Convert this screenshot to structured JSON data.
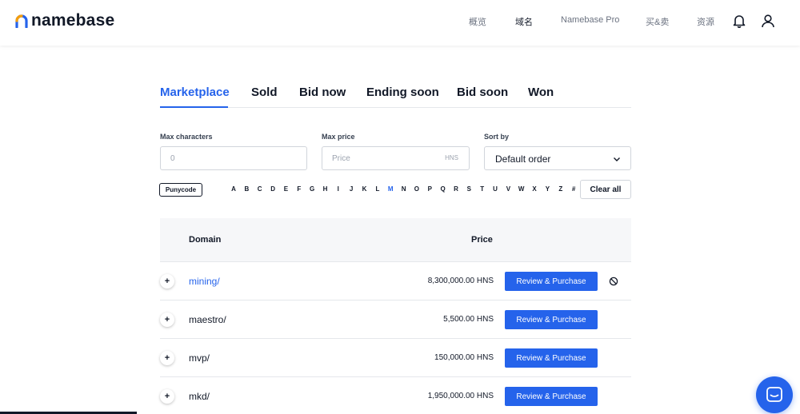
{
  "header": {
    "logo": "namebase",
    "nav": [
      "概览",
      "域名",
      "Namebase Pro",
      "买&卖",
      "资源"
    ],
    "active_nav": "域名",
    "icons": [
      "bell-icon",
      "user-icon"
    ]
  },
  "tabs": [
    "Marketplace",
    "Sold",
    "Bid now",
    "Ending soon",
    "Bid soon",
    "Won"
  ],
  "active_tab": "Marketplace",
  "filters": {
    "max_characters": {
      "label": "Max characters",
      "placeholder": "0"
    },
    "max_price": {
      "label": "Max price",
      "placeholder": "Price",
      "unit": "HNS"
    },
    "sort_by": {
      "label": "Sort by",
      "value": "Default order"
    }
  },
  "letters": {
    "punycode": "Punycode",
    "items": [
      "A",
      "B",
      "C",
      "D",
      "E",
      "F",
      "G",
      "H",
      "I",
      "J",
      "K",
      "L",
      "M",
      "N",
      "O",
      "P",
      "Q",
      "R",
      "S",
      "T",
      "U",
      "V",
      "W",
      "X",
      "Y",
      "Z",
      "#"
    ],
    "active": "M",
    "clear_label": "Clear all"
  },
  "table": {
    "headers": {
      "domain": "Domain",
      "price": "Price"
    },
    "rows": [
      {
        "domain": "mining/",
        "price": "8,300,000.00 HNS",
        "action": "Review & Purchase"
      },
      {
        "domain": "maestro/",
        "price": "5,500.00 HNS",
        "action": "Review & Purchase"
      },
      {
        "domain": "mvp/",
        "price": "150,000.00 HNS",
        "action": "Review & Purchase"
      },
      {
        "domain": "mkd/",
        "price": "1,950,000.00 HNS",
        "action": "Review & Purchase"
      }
    ],
    "expand_symbol": "+"
  },
  "colors": {
    "accent": "#2563eb",
    "text": "#111827",
    "muted": "#6b7280"
  }
}
